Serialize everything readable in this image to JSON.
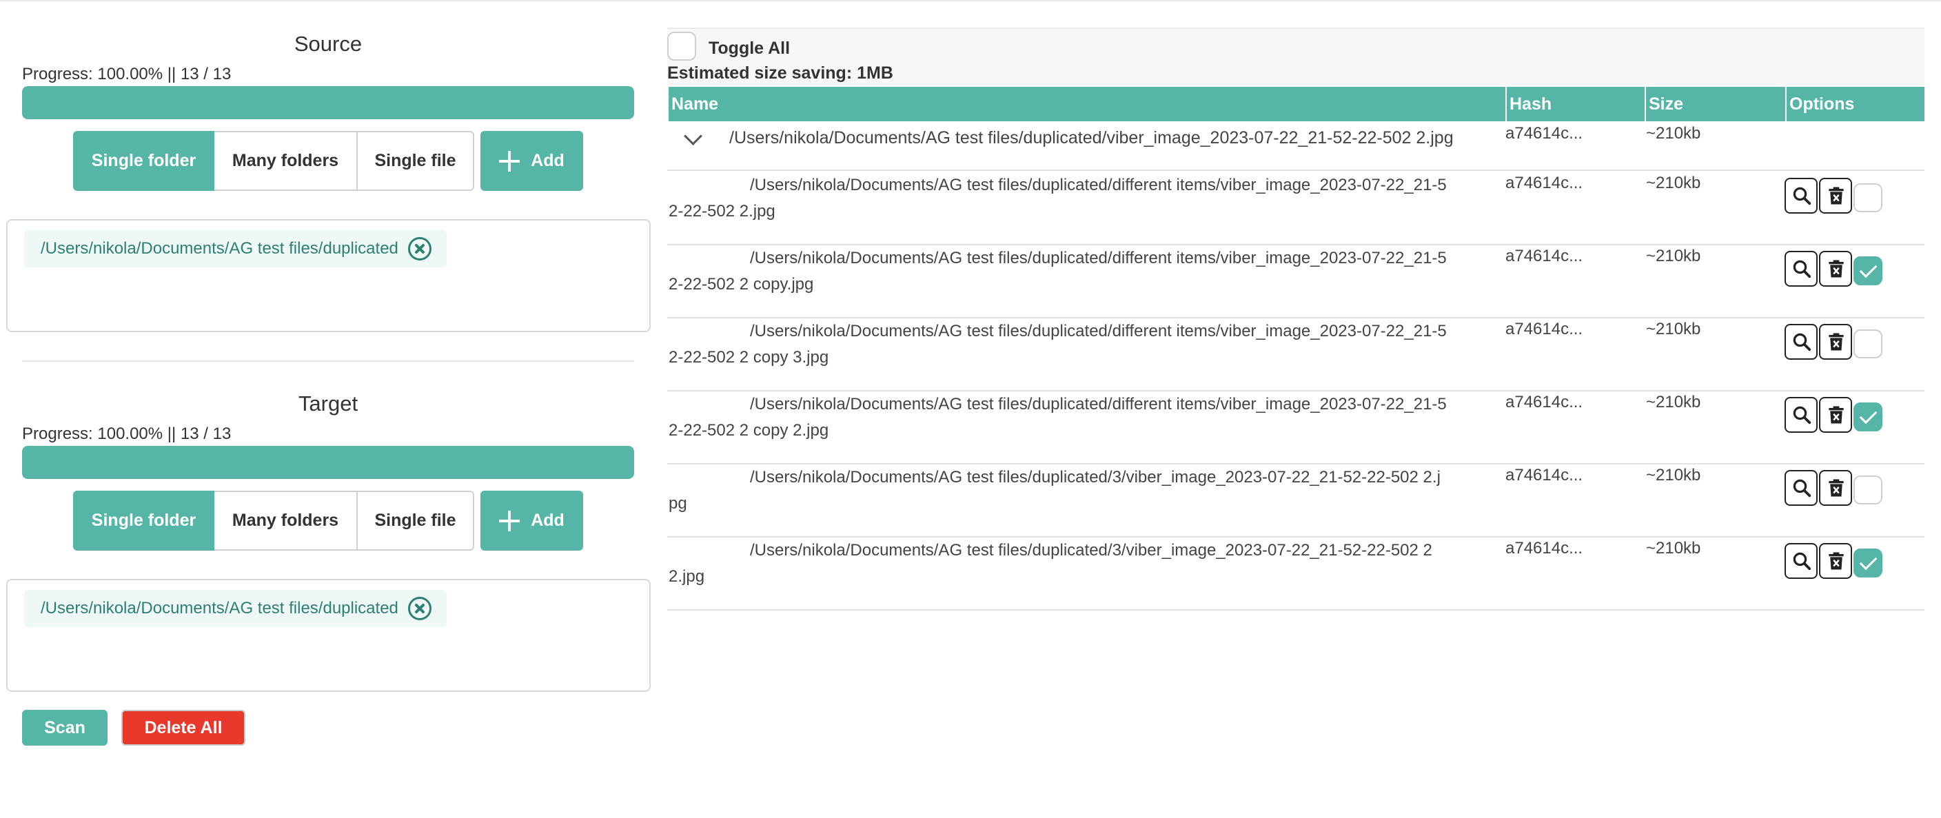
{
  "source": {
    "title": "Source",
    "progress_text": "Progress: 100.00% || 13 / 13",
    "progress_fraction": 1.0,
    "modes": [
      "Single folder",
      "Many folders",
      "Single file"
    ],
    "active_mode": "Single folder",
    "add_label": "Add",
    "paths": [
      "/Users/nikola/Documents/AG test files/duplicated"
    ]
  },
  "target": {
    "title": "Target",
    "progress_text": "Progress: 100.00% || 13 / 13",
    "progress_fraction": 1.0,
    "modes": [
      "Single folder",
      "Many folders",
      "Single file"
    ],
    "active_mode": "Single folder",
    "add_label": "Add",
    "paths": [
      "/Users/nikola/Documents/AG test files/duplicated"
    ]
  },
  "actions": {
    "scan_label": "Scan",
    "delete_all_label": "Delete All"
  },
  "results": {
    "toggle_all_label": "Toggle All",
    "toggle_all_checked": false,
    "estimated_saving": "Estimated size saving: 1MB",
    "columns": [
      "Name",
      "Hash",
      "Size",
      "Options"
    ],
    "group": {
      "name": "/Users/nikola/Documents/AG test files/duplicated/viber_image_2023-07-22_21-52-22-502 2.jpg",
      "hash": "a74614c...",
      "size": "~210kb",
      "expanded": true
    },
    "duplicates": [
      {
        "name_line1": "/Users/nikola/Documents/AG test files/duplicated/different items/viber_image_2023-07-22_21-5",
        "name_line2": "2-22-502 2.jpg",
        "hash": "a74614c...",
        "size": "~210kb",
        "checked": false
      },
      {
        "name_line1": "/Users/nikola/Documents/AG test files/duplicated/different items/viber_image_2023-07-22_21-5",
        "name_line2": "2-22-502 2 copy.jpg",
        "hash": "a74614c...",
        "size": "~210kb",
        "checked": true
      },
      {
        "name_line1": "/Users/nikola/Documents/AG test files/duplicated/different items/viber_image_2023-07-22_21-5",
        "name_line2": "2-22-502 2 copy 3.jpg",
        "hash": "a74614c...",
        "size": "~210kb",
        "checked": false
      },
      {
        "name_line1": "/Users/nikola/Documents/AG test files/duplicated/different items/viber_image_2023-07-22_21-5",
        "name_line2": "2-22-502 2 copy 2.jpg",
        "hash": "a74614c...",
        "size": "~210kb",
        "checked": true
      },
      {
        "name_line1": "/Users/nikola/Documents/AG test files/duplicated/3/viber_image_2023-07-22_21-52-22-502 2.j",
        "name_line2": "pg",
        "hash": "a74614c...",
        "size": "~210kb",
        "checked": false
      },
      {
        "name_line1": "/Users/nikola/Documents/AG test files/duplicated/3/viber_image_2023-07-22_21-52-22-502 2",
        "name_line2": "2.jpg",
        "hash": "a74614c...",
        "size": "~210kb",
        "checked": true
      }
    ]
  },
  "colors": {
    "accent": "#55b5a6",
    "danger": "#e8372b",
    "chip_text": "#2e7f73"
  },
  "icons": {
    "search": "search-icon",
    "delete": "trash-icon",
    "remove_path": "close-circle-icon",
    "expand": "chevron-down-icon",
    "add": "plus-icon"
  }
}
